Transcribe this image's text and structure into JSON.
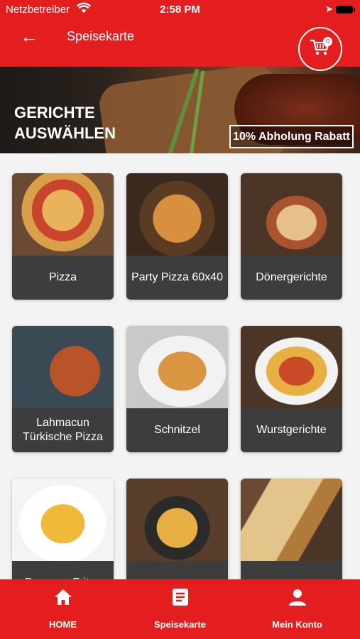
{
  "status_bar": {
    "carrier": "Netzbetreiber",
    "time": "2:58 PM"
  },
  "header": {
    "title": "Speisekarte",
    "cart_count": "0"
  },
  "banner": {
    "title_line1": "GERICHTE",
    "title_line2": "AUSWÄHLEN",
    "promo": "10% Abholung Rabatt"
  },
  "categories": [
    {
      "label": "Pizza"
    },
    {
      "label": "Party Pizza 60x40"
    },
    {
      "label": "Dönergerichte"
    },
    {
      "label": "Lahmacun Türkische Pizza"
    },
    {
      "label": "Schnitzel"
    },
    {
      "label": "Wurstgerichte"
    },
    {
      "label": "Pommes Frites"
    },
    {
      "label": ""
    },
    {
      "label": ""
    }
  ],
  "bottom_nav": {
    "home": "HOME",
    "menu": "Speisekarte",
    "account": "Mein Konto"
  },
  "colors": {
    "brand": "#e41e1e",
    "card_label_bg": "#3d3d3d"
  },
  "icons": {
    "back": "arrow-left-icon",
    "cart": "cart-icon",
    "home": "home-icon",
    "menu": "menu-list-icon",
    "account": "person-icon"
  }
}
